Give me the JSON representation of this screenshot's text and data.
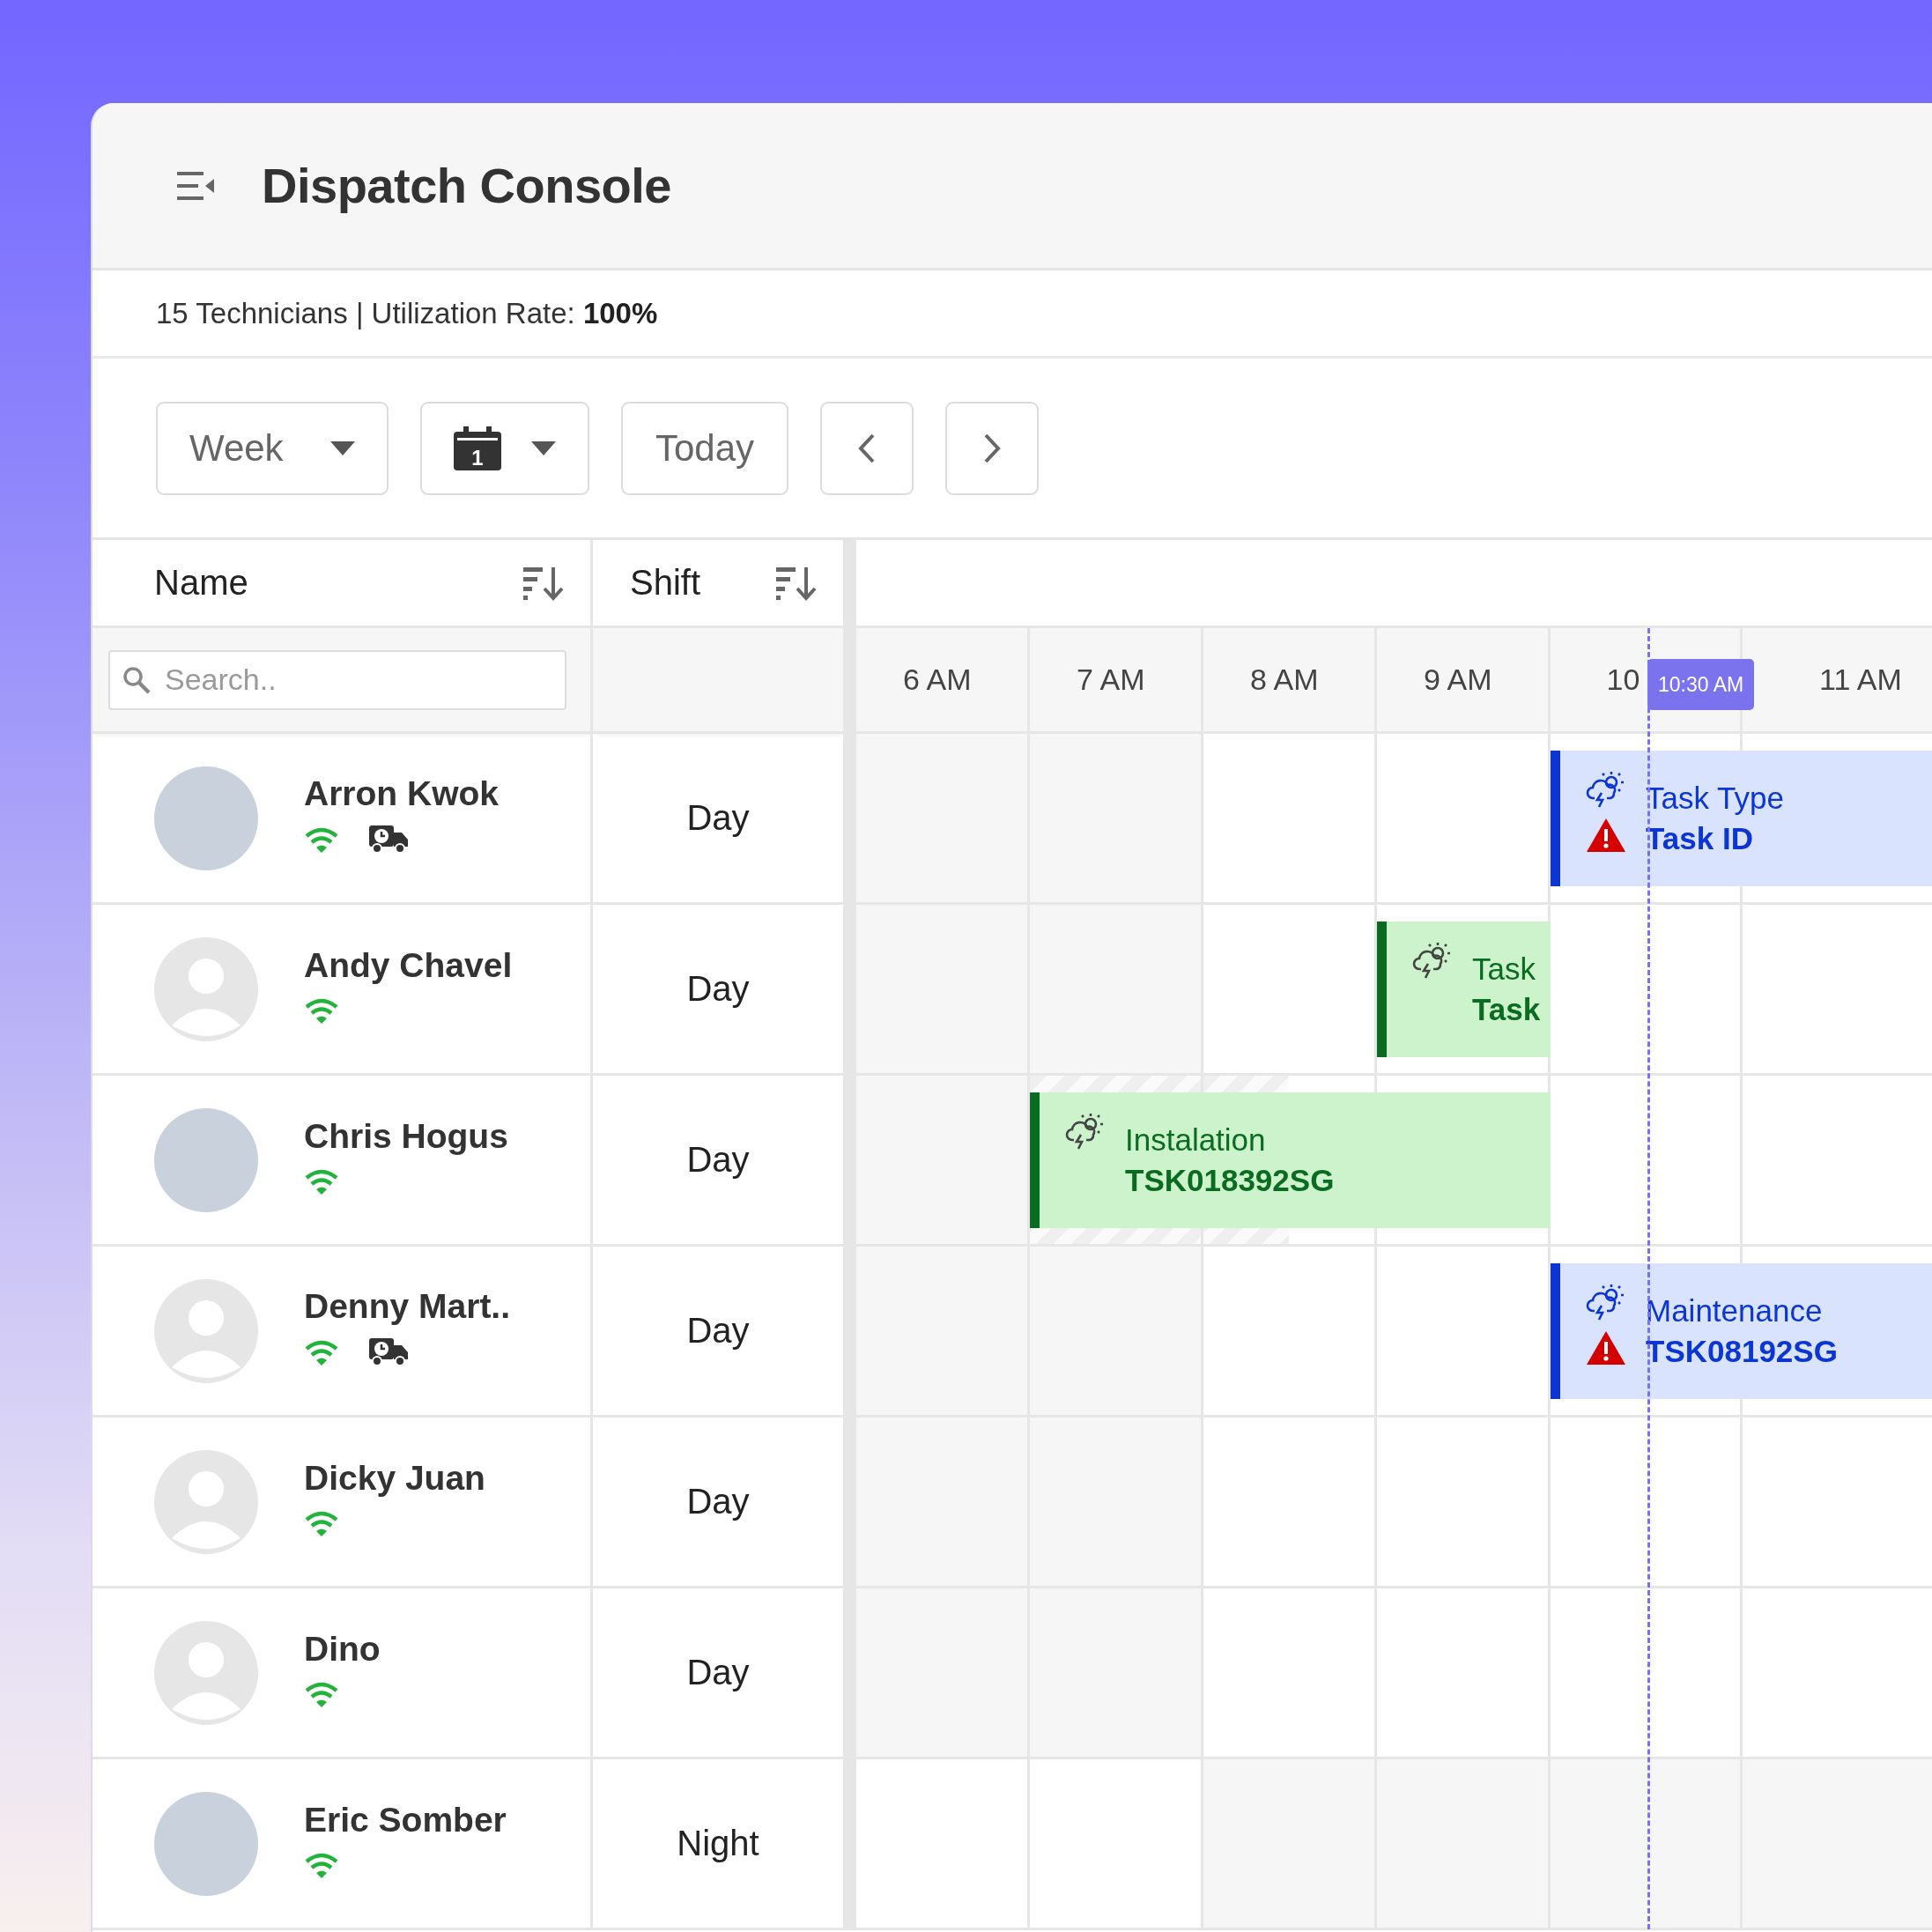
{
  "header": {
    "title": "Dispatch Console"
  },
  "summary": "15 Technicians | Utilization Rate: **100%**",
  "toolbar": {
    "view_select": {
      "value": "Week"
    },
    "date_picker": {
      "icon_day": "1"
    },
    "today_button": "Today"
  },
  "columns": [
    {
      "label": "Name"
    },
    {
      "label": "Shift"
    }
  ],
  "search": {
    "placeholder": "Search.."
  },
  "hours": [
    "6 AM",
    "7 AM",
    "8 AM",
    "9 AM",
    "10",
    "11 AM"
  ],
  "now_marker": {
    "label": "10:30 AM"
  },
  "technicians": [
    {
      "name": "Arron Kwok",
      "has_photo": true,
      "online": true,
      "vehicle": true,
      "shift": "Day",
      "cells": [
        {
          "kind": "shaded",
          "occupied": false
        },
        {
          "kind": "shaded",
          "occupied": false
        },
        {
          "kind": "blank",
          "occupied": false
        },
        {
          "kind": "blank",
          "occupied": false
        },
        {
          "kind": "blank",
          "occupied": true
        },
        {
          "kind": "blank",
          "occupied": true
        }
      ],
      "task": {
        "type": "Task Type",
        "id": "Task ID",
        "color": "#0b36d4",
        "warning": true
      }
    },
    {
      "name": "Andy Chavel",
      "has_photo": false,
      "online": true,
      "vehicle": false,
      "shift": "Day",
      "cells": [
        {
          "kind": "shaded",
          "occupied": false
        },
        {
          "kind": "shaded",
          "occupied": false
        },
        {
          "kind": "blank",
          "occupied": false
        },
        {
          "kind": "blank",
          "occupied": true
        },
        {
          "kind": "blank",
          "occupied": false
        },
        {
          "kind": "blank",
          "occupied": false
        }
      ],
      "task": {
        "type": "Task",
        "id": "Task",
        "color": "#0b6b21",
        "warning": false
      }
    },
    {
      "name": "Chris Hogus",
      "has_photo": true,
      "online": true,
      "vehicle": false,
      "shift": "Day",
      "cells": [
        {
          "kind": "shaded",
          "occupied": false
        },
        {
          "kind": "hatched",
          "occupied": true
        },
        {
          "kind": "half_hatched",
          "occupied": true
        },
        {
          "kind": "blank",
          "occupied": true
        },
        {
          "kind": "blank",
          "occupied": false
        },
        {
          "kind": "blank",
          "occupied": false
        }
      ],
      "task": {
        "type": "Instalation",
        "id": "TSK018392SG",
        "color": "#0b6b21",
        "warning": false
      }
    },
    {
      "name": "Denny Mart..",
      "has_photo": false,
      "online": true,
      "vehicle": true,
      "shift": "Day",
      "cells": [
        {
          "kind": "shaded",
          "occupied": false
        },
        {
          "kind": "shaded",
          "occupied": false
        },
        {
          "kind": "blank",
          "occupied": false
        },
        {
          "kind": "blank",
          "occupied": false
        },
        {
          "kind": "blank",
          "occupied": true
        },
        {
          "kind": "blank",
          "occupied": true
        }
      ],
      "task": {
        "type": "Maintenance",
        "id": "TSK08192SG",
        "color": "#0b36d4",
        "warning": true
      }
    },
    {
      "name": "Dicky Juan",
      "has_photo": false,
      "online": true,
      "vehicle": false,
      "shift": "Day",
      "cells": [
        {
          "kind": "shaded"
        },
        {
          "kind": "shaded"
        },
        {
          "kind": "blank"
        },
        {
          "kind": "blank"
        },
        {
          "kind": "blank"
        },
        {
          "kind": "blank"
        }
      ]
    },
    {
      "name": "Dino",
      "has_photo": false,
      "online": true,
      "vehicle": false,
      "shift": "Day",
      "cells": [
        {
          "kind": "shaded"
        },
        {
          "kind": "shaded"
        },
        {
          "kind": "blank"
        },
        {
          "kind": "blank"
        },
        {
          "kind": "blank"
        },
        {
          "kind": "blank"
        }
      ]
    },
    {
      "name": "Eric Somber",
      "has_photo": true,
      "online": true,
      "vehicle": false,
      "shift": "Night",
      "cells": [
        {
          "kind": "blank"
        },
        {
          "kind": "blank"
        },
        {
          "kind": "shaded"
        },
        {
          "kind": "shaded"
        },
        {
          "kind": "shaded"
        },
        {
          "kind": "shaded"
        }
      ]
    }
  ]
}
